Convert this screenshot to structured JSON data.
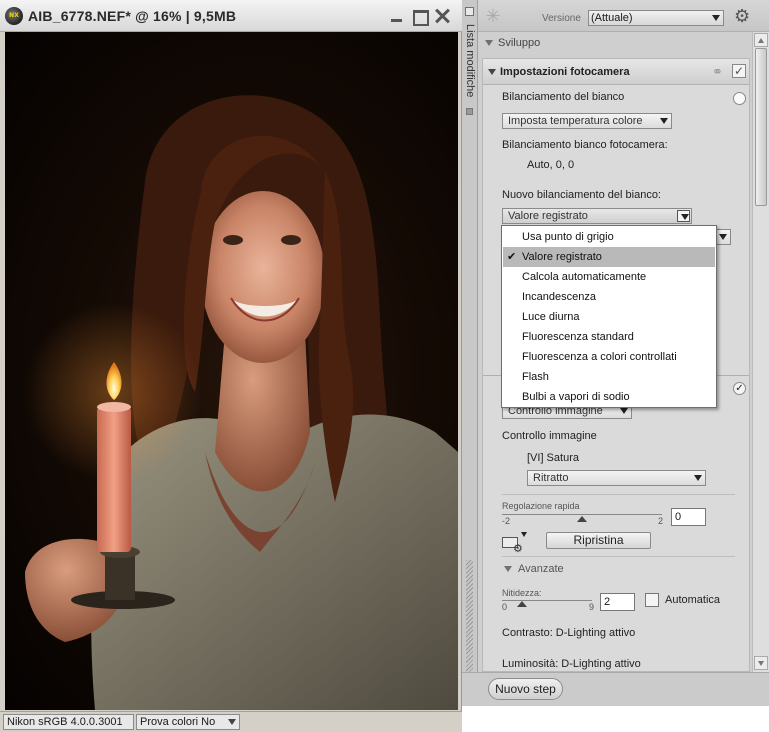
{
  "image_window": {
    "title": "AIB_6778.NEF* @ 16% | 9,5MB",
    "logo_text": "NX",
    "status": {
      "color_profile": "Nikon sRGB 4.0.0.3001",
      "softproof": "Prova colori No"
    }
  },
  "side_strip": {
    "label": "Lista modifiche"
  },
  "toolbar": {
    "version_label": "Versione",
    "version_value": "(Attuale)"
  },
  "section": {
    "title": "Sviluppo"
  },
  "camera_settings": {
    "title": "Impostazioni fotocamera",
    "white_balance_label": "Bilanciamento del bianco",
    "white_balance_mode": "Imposta temperatura colore",
    "camera_wb_label": "Bilanciamento bianco fotocamera:",
    "camera_wb_value": "Auto, 0, 0",
    "new_wb_label": "Nuovo bilanciamento del bianco:",
    "new_wb_value": "Valore registrato"
  },
  "wb_dropdown": {
    "items": [
      "Usa punto di grigio",
      "Valore registrato",
      "Calcola automaticamente",
      "Incandescenza",
      "Luce diurna",
      "Fluorescenza standard",
      "Fluorescenza a colori controllati",
      "Flash",
      "Bulbi a vapori di sodio"
    ],
    "selected_index": 1,
    "check_mark": "✔"
  },
  "picture_control": {
    "select_value": "Controllo immagine",
    "label": "Controllo immagine",
    "current": "[VI] Satura",
    "preset": "Ritratto",
    "quick_adjust_label": "Regolazione rapida",
    "quick_min": "-2",
    "quick_max": "2",
    "quick_value": "0",
    "reset_label": "Ripristina",
    "advanced_label": "Avanzate",
    "sharpness_label": "Nitidezza:",
    "sharp_min": "0",
    "sharp_max": "9",
    "sharpness_value": "2",
    "auto_label": "Automatica",
    "contrast_label": "Contrasto: D-Lighting attivo",
    "brightness_label": "Luminosità: D-Lighting attivo"
  },
  "footer": {
    "new_step_label": "Nuovo step"
  },
  "colors": {
    "panel_bg": "#cfcfcf",
    "selection": "#b9b9b9",
    "photo_bg": "#120904"
  }
}
